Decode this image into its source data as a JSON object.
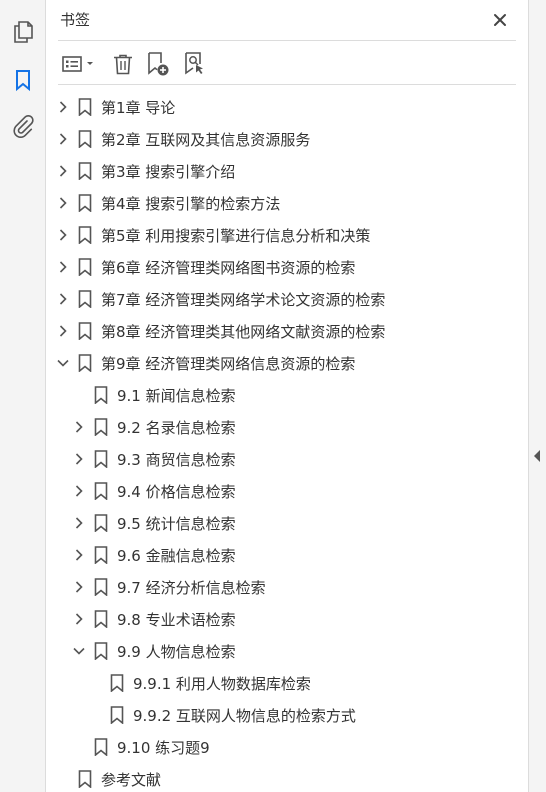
{
  "panel": {
    "title": "书签"
  },
  "toolbar": {
    "options_icon": "list-options-icon",
    "delete_icon": "trash-icon",
    "new_bookmark_icon": "add-bookmark-icon",
    "find_bookmark_icon": "find-bookmark-icon"
  },
  "rail": {
    "pages_icon": "pages-icon",
    "bookmarks_icon": "bookmark-icon",
    "attachments_icon": "paperclip-icon"
  },
  "colors": {
    "accent": "#1473e6",
    "icon": "#555555",
    "text": "#333333"
  },
  "bookmarks": [
    {
      "label": "第1章 导论",
      "level": 0,
      "toggle": "collapsed"
    },
    {
      "label": "第2章 互联网及其信息资源服务",
      "level": 0,
      "toggle": "collapsed"
    },
    {
      "label": "第3章 搜索引擎介绍",
      "level": 0,
      "toggle": "collapsed"
    },
    {
      "label": "第4章 搜索引擎的检索方法",
      "level": 0,
      "toggle": "collapsed"
    },
    {
      "label": "第5章 利用搜索引擎进行信息分析和决策",
      "level": 0,
      "toggle": "collapsed"
    },
    {
      "label": "第6章 经济管理类网络图书资源的检索",
      "level": 0,
      "toggle": "collapsed"
    },
    {
      "label": "第7章 经济管理类网络学术论文资源的检索",
      "level": 0,
      "toggle": "collapsed"
    },
    {
      "label": "第8章 经济管理类其他网络文献资源的检索",
      "level": 0,
      "toggle": "collapsed"
    },
    {
      "label": "第9章 经济管理类网络信息资源的检索",
      "level": 0,
      "toggle": "expanded"
    },
    {
      "label": "9.1 新闻信息检索",
      "level": 1,
      "toggle": "none"
    },
    {
      "label": "9.2 名录信息检索",
      "level": 1,
      "toggle": "collapsed"
    },
    {
      "label": "9.3 商贸信息检索",
      "level": 1,
      "toggle": "collapsed"
    },
    {
      "label": "9.4 价格信息检索",
      "level": 1,
      "toggle": "collapsed"
    },
    {
      "label": "9.5 统计信息检索",
      "level": 1,
      "toggle": "collapsed"
    },
    {
      "label": "9.6 金融信息检索",
      "level": 1,
      "toggle": "collapsed"
    },
    {
      "label": "9.7 经济分析信息检索",
      "level": 1,
      "toggle": "collapsed"
    },
    {
      "label": "9.8 专业术语检索",
      "level": 1,
      "toggle": "collapsed"
    },
    {
      "label": "9.9 人物信息检索",
      "level": 1,
      "toggle": "expanded"
    },
    {
      "label": "9.9.1 利用人物数据库检索",
      "level": 2,
      "toggle": "none"
    },
    {
      "label": "9.9.2 互联网人物信息的检索方式",
      "level": 2,
      "toggle": "none"
    },
    {
      "label": "9.10 练习题9",
      "level": 1,
      "toggle": "none"
    },
    {
      "label": "参考文献",
      "level": 0,
      "toggle": "none"
    }
  ]
}
